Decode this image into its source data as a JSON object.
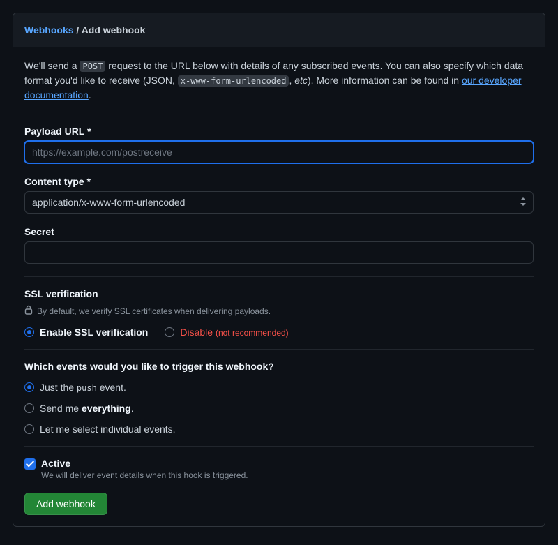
{
  "breadcrumb": {
    "parent": "Webhooks",
    "separator": "/",
    "current": "Add webhook"
  },
  "intro": {
    "part1": "We'll send a ",
    "code1": "POST",
    "part2": " request to the URL below with details of any subscribed events. You can also specify which data format you'd like to receive (JSON, ",
    "code2": "x-www-form-urlencoded",
    "part3": ", ",
    "em": "etc",
    "part4": "). More information can be found in ",
    "link": "our developer documentation",
    "part5": "."
  },
  "fields": {
    "payload_url": {
      "label": "Payload URL *",
      "placeholder": "https://example.com/postreceive",
      "value": ""
    },
    "content_type": {
      "label": "Content type *",
      "value": "application/x-www-form-urlencoded"
    },
    "secret": {
      "label": "Secret",
      "value": ""
    }
  },
  "ssl": {
    "heading": "SSL verification",
    "note": "By default, we verify SSL certificates when delivering payloads.",
    "enable": "Enable SSL verification",
    "disable": "Disable",
    "disable_note": "(not recommended)"
  },
  "events": {
    "heading": "Which events would you like to trigger this webhook?",
    "push_pre": "Just the ",
    "push_code": "push",
    "push_post": " event.",
    "everything_pre": "Send me ",
    "everything_strong": "everything",
    "everything_post": ".",
    "individual": "Let me select individual events."
  },
  "active": {
    "label": "Active",
    "desc": "We will deliver event details when this hook is triggered."
  },
  "submit": "Add webhook"
}
